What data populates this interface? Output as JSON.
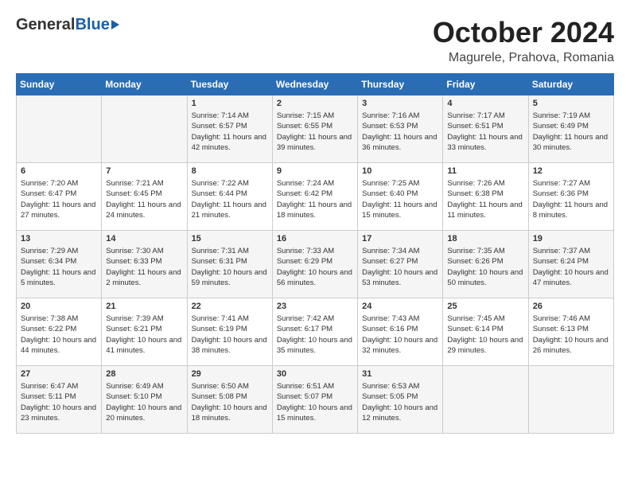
{
  "header": {
    "logo_general": "General",
    "logo_blue": "Blue",
    "month_year": "October 2024",
    "location": "Magurele, Prahova, Romania"
  },
  "days_of_week": [
    "Sunday",
    "Monday",
    "Tuesday",
    "Wednesday",
    "Thursday",
    "Friday",
    "Saturday"
  ],
  "weeks": [
    [
      {
        "day": "",
        "info": ""
      },
      {
        "day": "",
        "info": ""
      },
      {
        "day": "1",
        "info": "Sunrise: 7:14 AM\nSunset: 6:57 PM\nDaylight: 11 hours and 42 minutes."
      },
      {
        "day": "2",
        "info": "Sunrise: 7:15 AM\nSunset: 6:55 PM\nDaylight: 11 hours and 39 minutes."
      },
      {
        "day": "3",
        "info": "Sunrise: 7:16 AM\nSunset: 6:53 PM\nDaylight: 11 hours and 36 minutes."
      },
      {
        "day": "4",
        "info": "Sunrise: 7:17 AM\nSunset: 6:51 PM\nDaylight: 11 hours and 33 minutes."
      },
      {
        "day": "5",
        "info": "Sunrise: 7:19 AM\nSunset: 6:49 PM\nDaylight: 11 hours and 30 minutes."
      }
    ],
    [
      {
        "day": "6",
        "info": "Sunrise: 7:20 AM\nSunset: 6:47 PM\nDaylight: 11 hours and 27 minutes."
      },
      {
        "day": "7",
        "info": "Sunrise: 7:21 AM\nSunset: 6:45 PM\nDaylight: 11 hours and 24 minutes."
      },
      {
        "day": "8",
        "info": "Sunrise: 7:22 AM\nSunset: 6:44 PM\nDaylight: 11 hours and 21 minutes."
      },
      {
        "day": "9",
        "info": "Sunrise: 7:24 AM\nSunset: 6:42 PM\nDaylight: 11 hours and 18 minutes."
      },
      {
        "day": "10",
        "info": "Sunrise: 7:25 AM\nSunset: 6:40 PM\nDaylight: 11 hours and 15 minutes."
      },
      {
        "day": "11",
        "info": "Sunrise: 7:26 AM\nSunset: 6:38 PM\nDaylight: 11 hours and 11 minutes."
      },
      {
        "day": "12",
        "info": "Sunrise: 7:27 AM\nSunset: 6:36 PM\nDaylight: 11 hours and 8 minutes."
      }
    ],
    [
      {
        "day": "13",
        "info": "Sunrise: 7:29 AM\nSunset: 6:34 PM\nDaylight: 11 hours and 5 minutes."
      },
      {
        "day": "14",
        "info": "Sunrise: 7:30 AM\nSunset: 6:33 PM\nDaylight: 11 hours and 2 minutes."
      },
      {
        "day": "15",
        "info": "Sunrise: 7:31 AM\nSunset: 6:31 PM\nDaylight: 10 hours and 59 minutes."
      },
      {
        "day": "16",
        "info": "Sunrise: 7:33 AM\nSunset: 6:29 PM\nDaylight: 10 hours and 56 minutes."
      },
      {
        "day": "17",
        "info": "Sunrise: 7:34 AM\nSunset: 6:27 PM\nDaylight: 10 hours and 53 minutes."
      },
      {
        "day": "18",
        "info": "Sunrise: 7:35 AM\nSunset: 6:26 PM\nDaylight: 10 hours and 50 minutes."
      },
      {
        "day": "19",
        "info": "Sunrise: 7:37 AM\nSunset: 6:24 PM\nDaylight: 10 hours and 47 minutes."
      }
    ],
    [
      {
        "day": "20",
        "info": "Sunrise: 7:38 AM\nSunset: 6:22 PM\nDaylight: 10 hours and 44 minutes."
      },
      {
        "day": "21",
        "info": "Sunrise: 7:39 AM\nSunset: 6:21 PM\nDaylight: 10 hours and 41 minutes."
      },
      {
        "day": "22",
        "info": "Sunrise: 7:41 AM\nSunset: 6:19 PM\nDaylight: 10 hours and 38 minutes."
      },
      {
        "day": "23",
        "info": "Sunrise: 7:42 AM\nSunset: 6:17 PM\nDaylight: 10 hours and 35 minutes."
      },
      {
        "day": "24",
        "info": "Sunrise: 7:43 AM\nSunset: 6:16 PM\nDaylight: 10 hours and 32 minutes."
      },
      {
        "day": "25",
        "info": "Sunrise: 7:45 AM\nSunset: 6:14 PM\nDaylight: 10 hours and 29 minutes."
      },
      {
        "day": "26",
        "info": "Sunrise: 7:46 AM\nSunset: 6:13 PM\nDaylight: 10 hours and 26 minutes."
      }
    ],
    [
      {
        "day": "27",
        "info": "Sunrise: 6:47 AM\nSunset: 5:11 PM\nDaylight: 10 hours and 23 minutes."
      },
      {
        "day": "28",
        "info": "Sunrise: 6:49 AM\nSunset: 5:10 PM\nDaylight: 10 hours and 20 minutes."
      },
      {
        "day": "29",
        "info": "Sunrise: 6:50 AM\nSunset: 5:08 PM\nDaylight: 10 hours and 18 minutes."
      },
      {
        "day": "30",
        "info": "Sunrise: 6:51 AM\nSunset: 5:07 PM\nDaylight: 10 hours and 15 minutes."
      },
      {
        "day": "31",
        "info": "Sunrise: 6:53 AM\nSunset: 5:05 PM\nDaylight: 10 hours and 12 minutes."
      },
      {
        "day": "",
        "info": ""
      },
      {
        "day": "",
        "info": ""
      }
    ]
  ]
}
